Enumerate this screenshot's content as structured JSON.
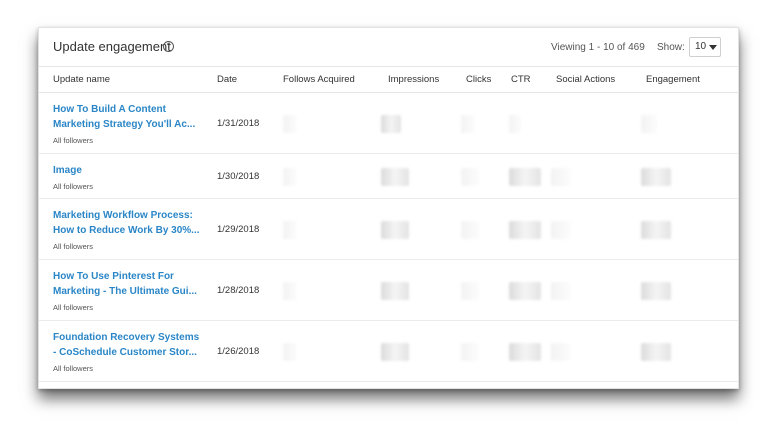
{
  "header": {
    "title": "Update engagement",
    "help_icon": "?",
    "viewing": "Viewing 1 - 10 of 469",
    "show_label": "Show:",
    "show_value": "10"
  },
  "columns": [
    "Update name",
    "Date",
    "Follows Acquired",
    "Impressions",
    "Clicks",
    "CTR",
    "Social Actions",
    "Engagement"
  ],
  "rows": [
    {
      "line1": "How To Build A Content",
      "line2": "Marketing Strategy You'll Ac...",
      "audience": "All followers",
      "date": "1/31/2018"
    },
    {
      "line1": "Image",
      "line2": "",
      "audience": "All followers",
      "date": "1/30/2018"
    },
    {
      "line1": "Marketing Workflow Process:",
      "line2": "How to Reduce Work By 30%...",
      "audience": "All followers",
      "date": "1/29/2018"
    },
    {
      "line1": "How To Use Pinterest For",
      "line2": "Marketing - The Ultimate Gui...",
      "audience": "All followers",
      "date": "1/28/2018"
    },
    {
      "line1": "Foundation Recovery Systems",
      "line2": "- CoSchedule Customer Stor...",
      "audience": "All followers",
      "date": "1/26/2018"
    }
  ]
}
